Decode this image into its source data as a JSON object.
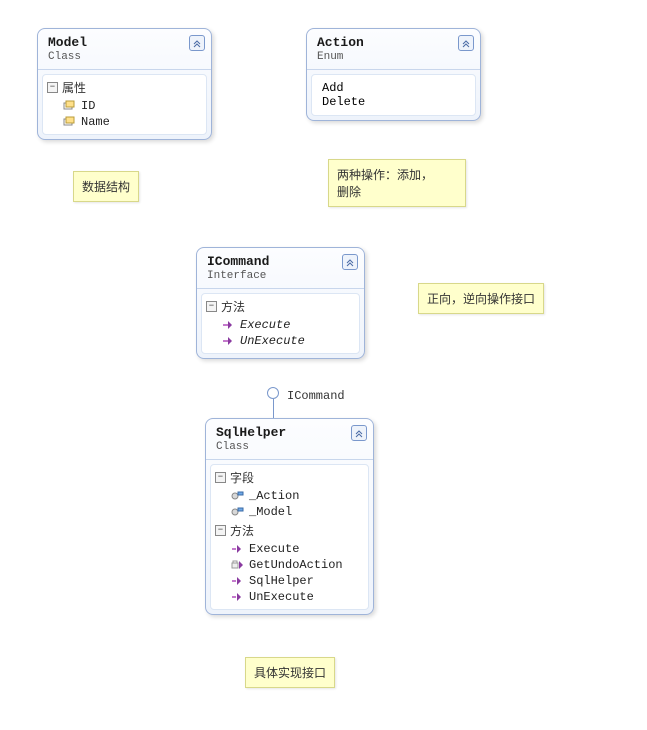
{
  "boxes": {
    "model": {
      "title": "Model",
      "stereo": "Class",
      "section1": "属性",
      "members": [
        "ID",
        "Name"
      ]
    },
    "action": {
      "title": "Action",
      "stereo": "Enum",
      "members": [
        "Add",
        "Delete"
      ]
    },
    "icommand": {
      "title": "ICommand",
      "stereo": "Interface",
      "section1": "方法",
      "members": [
        "Execute",
        "UnExecute"
      ]
    },
    "sqlhelper": {
      "title": "SqlHelper",
      "stereo": "Class",
      "section1": "字段",
      "fields": [
        "_Action",
        "_Model"
      ],
      "section2": "方法",
      "methods": [
        "Execute",
        "GetUndoAction",
        "SqlHelper",
        "UnExecute"
      ]
    }
  },
  "lollipop_label": "ICommand",
  "notes": {
    "n1": "数据结构",
    "n2_l1": "两种操作：添加，",
    "n2_l2": "删除",
    "n3": "正向，逆向操作接口",
    "n4": "具体实现接口"
  },
  "chart_data": {
    "type": "table",
    "title": "UML Class Diagram",
    "entities": [
      {
        "name": "Model",
        "kind": "Class",
        "properties": [
          "ID",
          "Name"
        ]
      },
      {
        "name": "Action",
        "kind": "Enum",
        "values": [
          "Add",
          "Delete"
        ]
      },
      {
        "name": "ICommand",
        "kind": "Interface",
        "methods": [
          "Execute",
          "UnExecute"
        ]
      },
      {
        "name": "SqlHelper",
        "kind": "Class",
        "implements": "ICommand",
        "fields": [
          "_Action",
          "_Model"
        ],
        "methods": [
          "Execute",
          "GetUndoAction",
          "SqlHelper",
          "UnExecute"
        ]
      }
    ],
    "notes": [
      {
        "target": "Model",
        "text": "数据结构"
      },
      {
        "target": "Action",
        "text": "两种操作：添加，删除"
      },
      {
        "target": "ICommand",
        "text": "正向，逆向操作接口"
      },
      {
        "target": "SqlHelper",
        "text": "具体实现接口"
      }
    ]
  }
}
